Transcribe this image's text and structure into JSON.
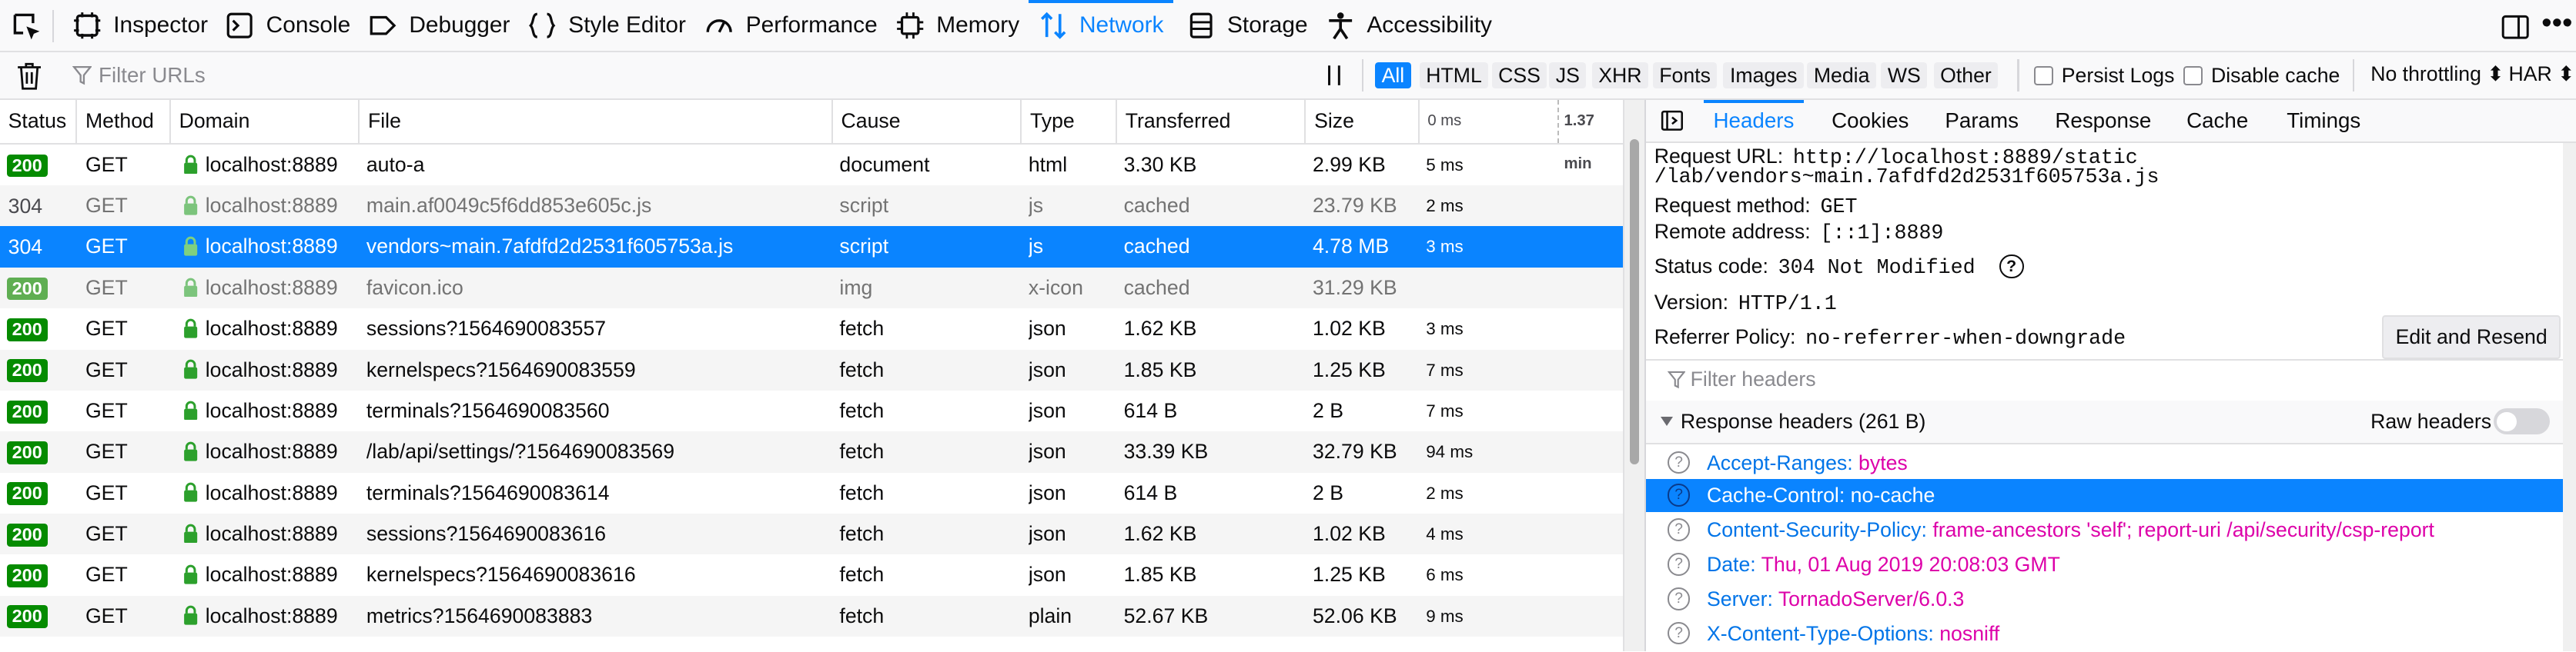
{
  "toolbar": {
    "tabs": [
      {
        "label": "Inspector",
        "icon": "inspector-icon"
      },
      {
        "label": "Console",
        "icon": "console-icon"
      },
      {
        "label": "Debugger",
        "icon": "debugger-icon"
      },
      {
        "label": "Style Editor",
        "icon": "style-editor-icon"
      },
      {
        "label": "Performance",
        "icon": "performance-icon"
      },
      {
        "label": "Memory",
        "icon": "memory-icon"
      },
      {
        "label": "Network",
        "icon": "network-icon"
      },
      {
        "label": "Storage",
        "icon": "storage-icon"
      },
      {
        "label": "Accessibility",
        "icon": "accessibility-icon"
      }
    ],
    "active_tab": "Network",
    "kebab": "•••"
  },
  "filterbar": {
    "placeholder": "Filter URLs",
    "types": [
      "All",
      "HTML",
      "CSS",
      "JS",
      "XHR",
      "Fonts",
      "Images",
      "Media",
      "WS",
      "Other"
    ],
    "selected_type": "All",
    "persist_logs": "Persist Logs",
    "disable_cache": "Disable cache",
    "throttling": "No throttling ⬍",
    "har": "HAR ⬍"
  },
  "table": {
    "columns": [
      "Status",
      "Method",
      "Domain",
      "File",
      "Cause",
      "Type",
      "Transferred",
      "Size"
    ],
    "waterfall_start": "0 ms",
    "waterfall_end": "1.37 min",
    "rows": [
      {
        "status": "200",
        "method": "GET",
        "domain": "localhost:8889",
        "file": "auto-a",
        "cause": "document",
        "type": "html",
        "transferred": "3.30 KB",
        "size": "2.99 KB",
        "time": "5 ms"
      },
      {
        "status": "304",
        "method": "GET",
        "domain": "localhost:8889",
        "file": "main.af0049c5f6dd853e605c.js",
        "cause": "script",
        "type": "js",
        "transferred": "cached",
        "size": "23.79 KB",
        "time": "2 ms"
      },
      {
        "status": "304",
        "method": "GET",
        "domain": "localhost:8889",
        "file": "vendors~main.7afdfd2d2531f605753a.js",
        "cause": "script",
        "type": "js",
        "transferred": "cached",
        "size": "4.78 MB",
        "time": "3 ms"
      },
      {
        "status": "200",
        "method": "GET",
        "domain": "localhost:8889",
        "file": "favicon.ico",
        "cause": "img",
        "type": "x-icon",
        "transferred": "cached",
        "size": "31.29 KB",
        "time": ""
      },
      {
        "status": "200",
        "method": "GET",
        "domain": "localhost:8889",
        "file": "sessions?1564690083557",
        "cause": "fetch",
        "type": "json",
        "transferred": "1.62 KB",
        "size": "1.02 KB",
        "time": "3 ms"
      },
      {
        "status": "200",
        "method": "GET",
        "domain": "localhost:8889",
        "file": "kernelspecs?1564690083559",
        "cause": "fetch",
        "type": "json",
        "transferred": "1.85 KB",
        "size": "1.25 KB",
        "time": "7 ms"
      },
      {
        "status": "200",
        "method": "GET",
        "domain": "localhost:8889",
        "file": "terminals?1564690083560",
        "cause": "fetch",
        "type": "json",
        "transferred": "614 B",
        "size": "2 B",
        "time": "7 ms"
      },
      {
        "status": "200",
        "method": "GET",
        "domain": "localhost:8889",
        "file": "/lab/api/settings/?1564690083569",
        "cause": "fetch",
        "type": "json",
        "transferred": "33.39 KB",
        "size": "32.79 KB",
        "time": "94 ms"
      },
      {
        "status": "200",
        "method": "GET",
        "domain": "localhost:8889",
        "file": "terminals?1564690083614",
        "cause": "fetch",
        "type": "json",
        "transferred": "614 B",
        "size": "2 B",
        "time": "2 ms"
      },
      {
        "status": "200",
        "method": "GET",
        "domain": "localhost:8889",
        "file": "sessions?1564690083616",
        "cause": "fetch",
        "type": "json",
        "transferred": "1.62 KB",
        "size": "1.02 KB",
        "time": "4 ms"
      },
      {
        "status": "200",
        "method": "GET",
        "domain": "localhost:8889",
        "file": "kernelspecs?1564690083616",
        "cause": "fetch",
        "type": "json",
        "transferred": "1.85 KB",
        "size": "1.25 KB",
        "time": "6 ms"
      },
      {
        "status": "200",
        "method": "GET",
        "domain": "localhost:8889",
        "file": "metrics?1564690083883",
        "cause": "fetch",
        "type": "plain",
        "transferred": "52.67 KB",
        "size": "52.06 KB",
        "time": "9 ms"
      }
    ]
  },
  "panel": {
    "tabs": [
      "Headers",
      "Cookies",
      "Params",
      "Response",
      "Cache",
      "Timings"
    ],
    "active_tab": "Headers",
    "request_url_label": "Request URL:",
    "request_url_line1": "http://localhost:8889/static",
    "request_url_line2": "/lab/vendors~main.7afdfd2d2531f605753a.js",
    "method_label": "Request method:",
    "method_value": "GET",
    "remote_label": "Remote address:",
    "remote_value": "[::1]:8889",
    "status_label": "Status code:",
    "status_value": "304 Not Modified",
    "version_label": "Version:",
    "version_value": "HTTP/1.1",
    "referrer_label": "Referrer Policy:",
    "referrer_value": "no-referrer-when-downgrade",
    "resend_label": "Edit and Resend",
    "filter_placeholder": "Filter headers",
    "response_headers_title": "Response headers (261 B)",
    "raw_headers_label": "Raw headers",
    "headers": [
      {
        "name": "Accept-Ranges:",
        "value": "bytes"
      },
      {
        "name": "Cache-Control:",
        "value": "no-cache"
      },
      {
        "name": "Content-Security-Policy:",
        "value": "frame-ancestors 'self'; report-uri /api/security/csp-report"
      },
      {
        "name": "Date:",
        "value": "Thu, 01 Aug 2019 20:08:03 GMT"
      },
      {
        "name": "Server:",
        "value": "TornadoServer/6.0.3"
      },
      {
        "name": "X-Content-Type-Options:",
        "value": "nosniff"
      }
    ]
  },
  "colors": {
    "accent": "#0a84ff",
    "status_ok": "#058b00",
    "header_name": "#0074e8",
    "header_value": "#dd00a9"
  }
}
